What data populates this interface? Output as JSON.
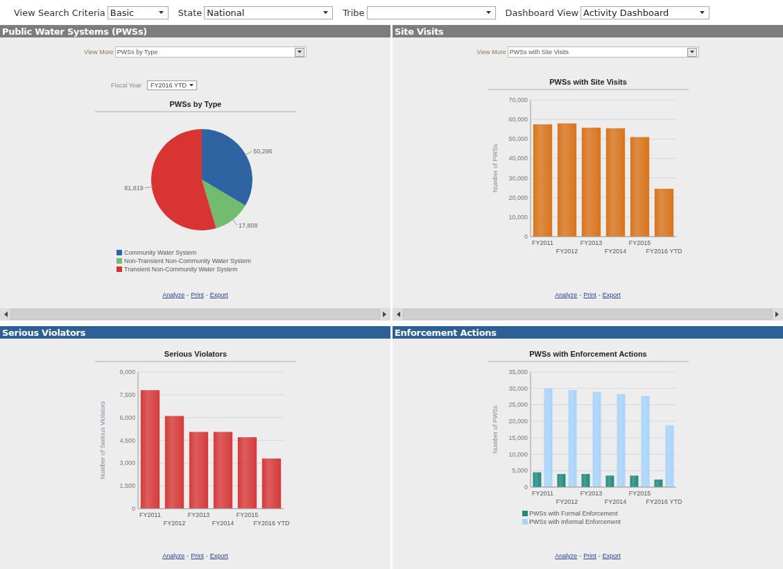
{
  "filters": [
    {
      "label": "View Search Criteria",
      "value": "Basic"
    },
    {
      "label": "State",
      "value": "National"
    },
    {
      "label": "Tribe"
    },
    {
      "label": "Dashboard View",
      "value": "Activity Dashboard"
    }
  ],
  "panels": [
    {
      "title": "Public Water Systems (PWSs)",
      "color": "#7d7d7d",
      "horizontal_scrollbar": true,
      "view_more": {
        "label": "View More",
        "value": "PWSs by Type"
      },
      "fiscal_year": {
        "label": "Fiscal Year",
        "value": "FY2016 YTD"
      },
      "chart_data": {
        "type": "pie",
        "title": "PWSs by Type",
        "value_labels": [
          "50,296",
          "17,808",
          "81,819"
        ],
        "legend": true,
        "categories": [
          "Community Water System",
          "Non-Transient Non-Community Water System",
          "Transient Non-Community Water System"
        ],
        "values": [
          50296,
          17808,
          81819
        ],
        "colors": [
          "#2f64a3",
          "#72bb6f",
          "#d93434"
        ]
      },
      "links": [
        "Analyze",
        "Print",
        "Export"
      ],
      "link_separator": "-"
    },
    {
      "title": "Site Visits",
      "color": "#7d7d7d",
      "horizontal_scrollbar": true,
      "view_more": {
        "label": "View More",
        "value": "PWSs with Site Visits"
      },
      "chart_data": {
        "type": "bar",
        "title": "PWSs with Site Visits",
        "ylabel": "Number of PWSs",
        "grid": true,
        "categories": [
          "FY2011",
          "FY2012",
          "FY2013",
          "FY2014",
          "FY2015",
          "FY2016 YTD"
        ],
        "ylim": [
          0,
          70000
        ],
        "yticks": [
          {
            "value": 0,
            "label": "0"
          },
          {
            "value": 10000,
            "label": "10,000"
          },
          {
            "value": 20000,
            "label": "20,000"
          },
          {
            "value": 30000,
            "label": "30,000"
          },
          {
            "value": 40000,
            "label": "40,000"
          },
          {
            "value": 50000,
            "label": "50,000"
          },
          {
            "value": 60000,
            "label": "60,000"
          },
          {
            "value": 70000,
            "label": "70,000"
          }
        ],
        "series": [
          {
            "color": "#d9741c",
            "values": [
              57500,
              58000,
              55800,
              55500,
              51000,
              24500
            ]
          }
        ]
      },
      "links": [
        "Analyze",
        "Print",
        "Export"
      ],
      "link_separator": "-"
    },
    {
      "title": "Serious Violators",
      "color": "#2d6094",
      "horizontal_scrollbar": false,
      "chart_data": {
        "type": "bar",
        "title": "Serious Violators",
        "ylabel": "Number of Serious Violators",
        "grid": true,
        "categories": [
          "FY2011",
          "FY2012",
          "FY2013",
          "FY2014",
          "FY2015",
          "FY2016 YTD"
        ],
        "ylim": [
          0,
          9000
        ],
        "yticks": [
          {
            "value": 0,
            "label": "0"
          },
          {
            "value": 1500,
            "label": "1,500"
          },
          {
            "value": 3000,
            "label": "3,000"
          },
          {
            "value": 4500,
            "label": "4,500"
          },
          {
            "value": 6000,
            "label": "6,000"
          },
          {
            "value": 7500,
            "label": "7,500"
          },
          {
            "value": 9000,
            "label": "9,000"
          }
        ],
        "series": [
          {
            "color": "#d63a3a",
            "values": [
              7800,
              6100,
              5050,
              5050,
              4700,
              3300
            ]
          }
        ]
      },
      "links": [
        "Analyze",
        "Print",
        "Export"
      ],
      "link_separator": "-"
    },
    {
      "title": "Enforcement Actions",
      "color": "#2d6094",
      "horizontal_scrollbar": false,
      "chart_data": {
        "type": "bar",
        "title": "PWSs with Enforcement Actions",
        "ylabel": "Number of PWSs",
        "grid": true,
        "legend": true,
        "categories": [
          "FY2011",
          "FY2012",
          "FY2013",
          "FY2014",
          "FY2015",
          "FY2016 YTD"
        ],
        "ylim": [
          0,
          35000
        ],
        "yticks": [
          {
            "value": 0,
            "label": "0"
          },
          {
            "value": 5000,
            "label": "5,000"
          },
          {
            "value": 10000,
            "label": "10,000"
          },
          {
            "value": 15000,
            "label": "15,000"
          },
          {
            "value": 20000,
            "label": "20,000"
          },
          {
            "value": 25000,
            "label": "25,000"
          },
          {
            "value": 30000,
            "label": "30,000"
          },
          {
            "value": 35000,
            "label": "35,000"
          }
        ],
        "series": [
          {
            "name": "PWSs with Formal Enforcement",
            "color": "#1f8a7e",
            "values": [
              4500,
              4000,
              4000,
              3500,
              3500,
              2300
            ]
          },
          {
            "name": "PWSs with Informal Enforcement",
            "color": "#a8d4fb",
            "values": [
              30000,
              29500,
              28900,
              28300,
              27700,
              18800
            ]
          }
        ]
      },
      "links": [
        "Analyze",
        "Print",
        "Export"
      ],
      "link_separator": "-"
    }
  ]
}
